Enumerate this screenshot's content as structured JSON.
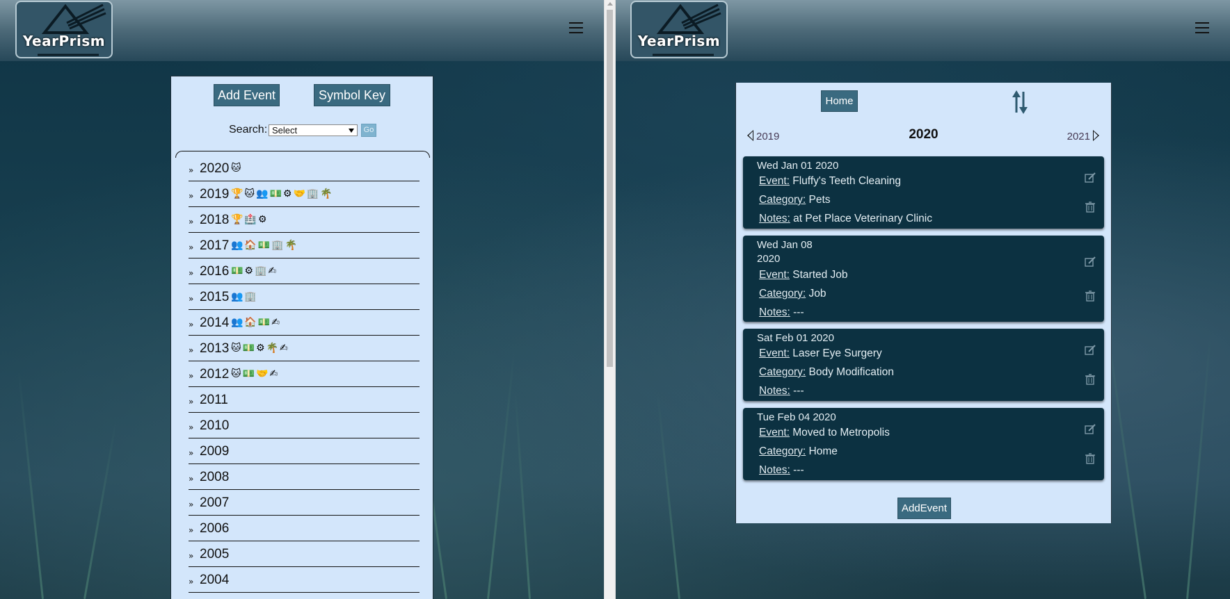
{
  "app": {
    "name": "YearPrism"
  },
  "left": {
    "add_event_label": "Add Event",
    "symbol_key_label": "Symbol Key",
    "search_label": "Search:",
    "search_select_value": "Select",
    "go_label": "Go",
    "years": [
      {
        "year": "2020",
        "symbols": "🐱"
      },
      {
        "year": "2019",
        "symbols": "🏆🐱👥💵⚙🤝🏢🌴"
      },
      {
        "year": "2018",
        "symbols": "🏆🏥⚙"
      },
      {
        "year": "2017",
        "symbols": "👥🏠💵🏢🌴"
      },
      {
        "year": "2016",
        "symbols": "💵⚙🏢✍"
      },
      {
        "year": "2015",
        "symbols": "👥🏢"
      },
      {
        "year": "2014",
        "symbols": "👥🏠💵✍"
      },
      {
        "year": "2013",
        "symbols": "🐱💵⚙🌴✍"
      },
      {
        "year": "2012",
        "symbols": "🐱💵🤝✍"
      },
      {
        "year": "2011",
        "symbols": ""
      },
      {
        "year": "2010",
        "symbols": ""
      },
      {
        "year": "2009",
        "symbols": ""
      },
      {
        "year": "2008",
        "symbols": ""
      },
      {
        "year": "2007",
        "symbols": ""
      },
      {
        "year": "2006",
        "symbols": ""
      },
      {
        "year": "2005",
        "symbols": ""
      },
      {
        "year": "2004",
        "symbols": ""
      }
    ]
  },
  "right": {
    "home_label": "Home",
    "prev_year": "2019",
    "current_year": "2020",
    "next_year": "2021",
    "add_event_label": "AddEvent",
    "labels": {
      "event": "Event:",
      "category": "Category:",
      "notes": "Notes:"
    },
    "events": [
      {
        "date": "Wed Jan 01 2020",
        "event": "Fluffy's Teeth Cleaning",
        "category": "Pets",
        "notes": "at Pet Place Veterinary Clinic"
      },
      {
        "date": "Wed Jan 08 2020",
        "event": "Started Job",
        "category": "Job",
        "notes": "---"
      },
      {
        "date": "Sat Feb 01 2020",
        "event": "Laser Eye Surgery",
        "category": "Body Modification",
        "notes": "---"
      },
      {
        "date": "Tue Feb 04 2020",
        "event": "Moved to Metropolis",
        "category": "Home",
        "notes": "---"
      }
    ]
  },
  "icons": [
    "menu-icon",
    "chevron-right-icon",
    "sort-arrows-icon",
    "edit-icon",
    "trash-icon",
    "triangle-left-icon",
    "triangle-right-icon"
  ],
  "colors": {
    "header_top": "#7e97a4",
    "header_bottom": "#274859",
    "panel": "#d3e6fb",
    "button": "#3a6a80",
    "card": "#0c3141"
  }
}
